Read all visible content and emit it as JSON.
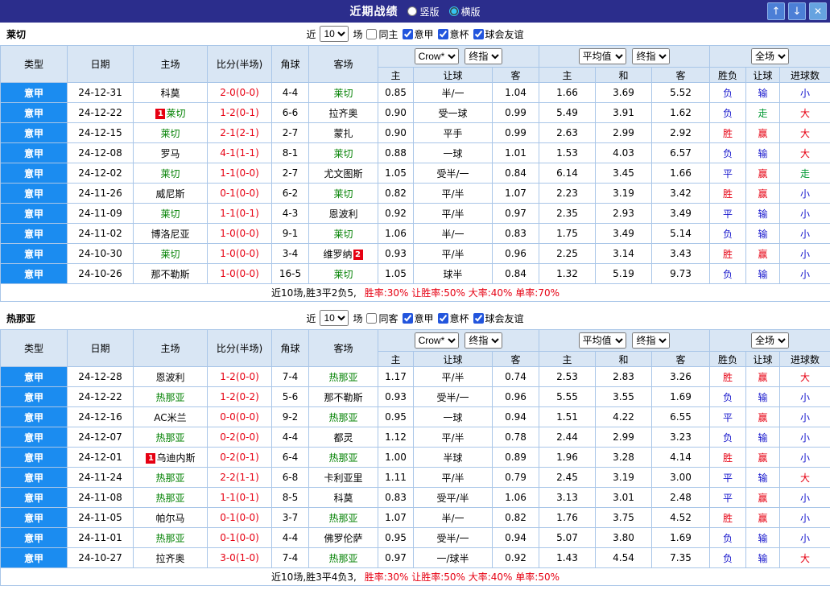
{
  "palette": {
    "r": "#e60012",
    "b": "#1515cc",
    "g": "#009933",
    "league_bg": "#1b8cf0",
    "focal_team": "#008000",
    "score": "#e60012",
    "titlebar_bg": "#2b2d8c"
  },
  "titlebar": {
    "title": "近期战绩",
    "vertical_label": "竖版",
    "horizontal_label": "横版",
    "vertical_selected": false,
    "horizontal_selected": true,
    "up_icon": "↑",
    "down_icon": "↓",
    "close_icon": "✕"
  },
  "labels": {
    "near": "近",
    "count_value": "10",
    "matches": "场",
    "cols": [
      "类型",
      "日期",
      "主场",
      "比分(半场)",
      "角球",
      "客场"
    ],
    "bookmaker": "Crow*",
    "final": "终指",
    "average": "平均值",
    "fulltime": "全场",
    "odds_sub": [
      "主",
      "让球",
      "客"
    ],
    "avg_sub": [
      "主",
      "和",
      "客"
    ],
    "result_sub": [
      "胜负",
      "让球",
      "进球数"
    ]
  },
  "sections": [
    {
      "team": "莱切",
      "filters": [
        {
          "label": "同主",
          "checked": false
        },
        {
          "label": "意甲",
          "checked": true
        },
        {
          "label": "意杯",
          "checked": true
        },
        {
          "label": "球会友谊",
          "checked": true
        }
      ],
      "rows": [
        {
          "league": "意甲",
          "date": "24-12-31",
          "home": {
            "text": "科莫",
            "focal": false
          },
          "score": "2-0(0-0)",
          "corner": "4-4",
          "away": {
            "text": "莱切",
            "focal": true
          },
          "odds": [
            "0.85",
            "半/一",
            "1.04"
          ],
          "avg": [
            "1.66",
            "3.69",
            "5.52"
          ],
          "res": [
            [
              "负",
              "b"
            ],
            [
              "输",
              "b"
            ],
            [
              "小",
              "b"
            ]
          ]
        },
        {
          "league": "意甲",
          "date": "24-12-22",
          "home": {
            "text": "莱切",
            "focal": true,
            "badge": "1",
            "badge_pos": "before"
          },
          "score": "1-2(0-1)",
          "corner": "6-6",
          "away": {
            "text": "拉齐奥",
            "focal": false
          },
          "odds": [
            "0.90",
            "受一球",
            "0.99"
          ],
          "avg": [
            "5.49",
            "3.91",
            "1.62"
          ],
          "res": [
            [
              "负",
              "b"
            ],
            [
              "走",
              "g"
            ],
            [
              "大",
              "r"
            ]
          ]
        },
        {
          "league": "意甲",
          "date": "24-12-15",
          "home": {
            "text": "莱切",
            "focal": true
          },
          "score": "2-1(2-1)",
          "corner": "2-7",
          "away": {
            "text": "蒙扎",
            "focal": false
          },
          "odds": [
            "0.90",
            "平手",
            "0.99"
          ],
          "avg": [
            "2.63",
            "2.99",
            "2.92"
          ],
          "res": [
            [
              "胜",
              "r"
            ],
            [
              "赢",
              "r"
            ],
            [
              "大",
              "r"
            ]
          ]
        },
        {
          "league": "意甲",
          "date": "24-12-08",
          "home": {
            "text": "罗马",
            "focal": false
          },
          "score": "4-1(1-1)",
          "corner": "8-1",
          "away": {
            "text": "莱切",
            "focal": true
          },
          "odds": [
            "0.88",
            "一球",
            "1.01"
          ],
          "avg": [
            "1.53",
            "4.03",
            "6.57"
          ],
          "res": [
            [
              "负",
              "b"
            ],
            [
              "输",
              "b"
            ],
            [
              "大",
              "r"
            ]
          ]
        },
        {
          "league": "意甲",
          "date": "24-12-02",
          "home": {
            "text": "莱切",
            "focal": true
          },
          "score": "1-1(0-0)",
          "corner": "2-7",
          "away": {
            "text": "尤文图斯",
            "focal": false
          },
          "odds": [
            "1.05",
            "受半/一",
            "0.84"
          ],
          "avg": [
            "6.14",
            "3.45",
            "1.66"
          ],
          "res": [
            [
              "平",
              "b"
            ],
            [
              "赢",
              "r"
            ],
            [
              "走",
              "g"
            ]
          ]
        },
        {
          "league": "意甲",
          "date": "24-11-26",
          "home": {
            "text": "威尼斯",
            "focal": false
          },
          "score": "0-1(0-0)",
          "corner": "6-2",
          "away": {
            "text": "莱切",
            "focal": true
          },
          "odds": [
            "0.82",
            "平/半",
            "1.07"
          ],
          "avg": [
            "2.23",
            "3.19",
            "3.42"
          ],
          "res": [
            [
              "胜",
              "r"
            ],
            [
              "赢",
              "r"
            ],
            [
              "小",
              "b"
            ]
          ]
        },
        {
          "league": "意甲",
          "date": "24-11-09",
          "home": {
            "text": "莱切",
            "focal": true
          },
          "score": "1-1(0-1)",
          "corner": "4-3",
          "away": {
            "text": "恩波利",
            "focal": false
          },
          "odds": [
            "0.92",
            "平/半",
            "0.97"
          ],
          "avg": [
            "2.35",
            "2.93",
            "3.49"
          ],
          "res": [
            [
              "平",
              "b"
            ],
            [
              "输",
              "b"
            ],
            [
              "小",
              "b"
            ]
          ]
        },
        {
          "league": "意甲",
          "date": "24-11-02",
          "home": {
            "text": "博洛尼亚",
            "focal": false
          },
          "score": "1-0(0-0)",
          "corner": "9-1",
          "away": {
            "text": "莱切",
            "focal": true
          },
          "odds": [
            "1.06",
            "半/一",
            "0.83"
          ],
          "avg": [
            "1.75",
            "3.49",
            "5.14"
          ],
          "res": [
            [
              "负",
              "b"
            ],
            [
              "输",
              "b"
            ],
            [
              "小",
              "b"
            ]
          ]
        },
        {
          "league": "意甲",
          "date": "24-10-30",
          "home": {
            "text": "莱切",
            "focal": true
          },
          "score": "1-0(0-0)",
          "corner": "3-4",
          "away": {
            "text": "维罗纳",
            "focal": false,
            "badge": "2",
            "badge_pos": "after"
          },
          "odds": [
            "0.93",
            "平/半",
            "0.96"
          ],
          "avg": [
            "2.25",
            "3.14",
            "3.43"
          ],
          "res": [
            [
              "胜",
              "r"
            ],
            [
              "赢",
              "r"
            ],
            [
              "小",
              "b"
            ]
          ]
        },
        {
          "league": "意甲",
          "date": "24-10-26",
          "home": {
            "text": "那不勒斯",
            "focal": false
          },
          "score": "1-0(0-0)",
          "corner": "16-5",
          "away": {
            "text": "莱切",
            "focal": true
          },
          "odds": [
            "1.05",
            "球半",
            "0.84"
          ],
          "avg": [
            "1.32",
            "5.19",
            "9.73"
          ],
          "res": [
            [
              "负",
              "b"
            ],
            [
              "输",
              "b"
            ],
            [
              "小",
              "b"
            ]
          ]
        }
      ],
      "summary_main": "近10场,胜3平2负5,",
      "summary_rates": "胜率:30% 让胜率:50% 大率:40% 单率:70%"
    },
    {
      "team": "热那亚",
      "filters": [
        {
          "label": "同客",
          "checked": false
        },
        {
          "label": "意甲",
          "checked": true
        },
        {
          "label": "意杯",
          "checked": true
        },
        {
          "label": "球会友谊",
          "checked": true
        }
      ],
      "rows": [
        {
          "league": "意甲",
          "date": "24-12-28",
          "home": {
            "text": "恩波利",
            "focal": false
          },
          "score": "1-2(0-0)",
          "corner": "7-4",
          "away": {
            "text": "热那亚",
            "focal": true
          },
          "odds": [
            "1.17",
            "平/半",
            "0.74"
          ],
          "avg": [
            "2.53",
            "2.83",
            "3.26"
          ],
          "res": [
            [
              "胜",
              "r"
            ],
            [
              "赢",
              "r"
            ],
            [
              "大",
              "r"
            ]
          ]
        },
        {
          "league": "意甲",
          "date": "24-12-22",
          "home": {
            "text": "热那亚",
            "focal": true
          },
          "score": "1-2(0-2)",
          "corner": "5-6",
          "away": {
            "text": "那不勒斯",
            "focal": false
          },
          "odds": [
            "0.93",
            "受半/一",
            "0.96"
          ],
          "avg": [
            "5.55",
            "3.55",
            "1.69"
          ],
          "res": [
            [
              "负",
              "b"
            ],
            [
              "输",
              "b"
            ],
            [
              "小",
              "b"
            ]
          ]
        },
        {
          "league": "意甲",
          "date": "24-12-16",
          "home": {
            "text": "AC米兰",
            "focal": false
          },
          "score": "0-0(0-0)",
          "corner": "9-2",
          "away": {
            "text": "热那亚",
            "focal": true
          },
          "odds": [
            "0.95",
            "一球",
            "0.94"
          ],
          "avg": [
            "1.51",
            "4.22",
            "6.55"
          ],
          "res": [
            [
              "平",
              "b"
            ],
            [
              "赢",
              "r"
            ],
            [
              "小",
              "b"
            ]
          ]
        },
        {
          "league": "意甲",
          "date": "24-12-07",
          "home": {
            "text": "热那亚",
            "focal": true
          },
          "score": "0-2(0-0)",
          "corner": "4-4",
          "away": {
            "text": "都灵",
            "focal": false
          },
          "odds": [
            "1.12",
            "平/半",
            "0.78"
          ],
          "avg": [
            "2.44",
            "2.99",
            "3.23"
          ],
          "res": [
            [
              "负",
              "b"
            ],
            [
              "输",
              "b"
            ],
            [
              "小",
              "b"
            ]
          ]
        },
        {
          "league": "意甲",
          "date": "24-12-01",
          "home": {
            "text": "乌迪内斯",
            "focal": false,
            "badge": "1",
            "badge_pos": "before"
          },
          "score": "0-2(0-1)",
          "corner": "6-4",
          "away": {
            "text": "热那亚",
            "focal": true
          },
          "odds": [
            "1.00",
            "半球",
            "0.89"
          ],
          "avg": [
            "1.96",
            "3.28",
            "4.14"
          ],
          "res": [
            [
              "胜",
              "r"
            ],
            [
              "赢",
              "r"
            ],
            [
              "小",
              "b"
            ]
          ]
        },
        {
          "league": "意甲",
          "date": "24-11-24",
          "home": {
            "text": "热那亚",
            "focal": true
          },
          "score": "2-2(1-1)",
          "corner": "6-8",
          "away": {
            "text": "卡利亚里",
            "focal": false
          },
          "odds": [
            "1.11",
            "平/半",
            "0.79"
          ],
          "avg": [
            "2.45",
            "3.19",
            "3.00"
          ],
          "res": [
            [
              "平",
              "b"
            ],
            [
              "输",
              "b"
            ],
            [
              "大",
              "r"
            ]
          ]
        },
        {
          "league": "意甲",
          "date": "24-11-08",
          "home": {
            "text": "热那亚",
            "focal": true
          },
          "score": "1-1(0-1)",
          "corner": "8-5",
          "away": {
            "text": "科莫",
            "focal": false
          },
          "odds": [
            "0.83",
            "受平/半",
            "1.06"
          ],
          "avg": [
            "3.13",
            "3.01",
            "2.48"
          ],
          "res": [
            [
              "平",
              "b"
            ],
            [
              "赢",
              "r"
            ],
            [
              "小",
              "b"
            ]
          ]
        },
        {
          "league": "意甲",
          "date": "24-11-05",
          "home": {
            "text": "帕尔马",
            "focal": false
          },
          "score": "0-1(0-0)",
          "corner": "3-7",
          "away": {
            "text": "热那亚",
            "focal": true
          },
          "odds": [
            "1.07",
            "半/一",
            "0.82"
          ],
          "avg": [
            "1.76",
            "3.75",
            "4.52"
          ],
          "res": [
            [
              "胜",
              "r"
            ],
            [
              "赢",
              "r"
            ],
            [
              "小",
              "b"
            ]
          ]
        },
        {
          "league": "意甲",
          "date": "24-11-01",
          "home": {
            "text": "热那亚",
            "focal": true
          },
          "score": "0-1(0-0)",
          "corner": "4-4",
          "away": {
            "text": "佛罗伦萨",
            "focal": false
          },
          "odds": [
            "0.95",
            "受半/一",
            "0.94"
          ],
          "avg": [
            "5.07",
            "3.80",
            "1.69"
          ],
          "res": [
            [
              "负",
              "b"
            ],
            [
              "输",
              "b"
            ],
            [
              "小",
              "b"
            ]
          ]
        },
        {
          "league": "意甲",
          "date": "24-10-27",
          "home": {
            "text": "拉齐奥",
            "focal": false
          },
          "score": "3-0(1-0)",
          "corner": "7-4",
          "away": {
            "text": "热那亚",
            "focal": true
          },
          "odds": [
            "0.97",
            "一/球半",
            "0.92"
          ],
          "avg": [
            "1.43",
            "4.54",
            "7.35"
          ],
          "res": [
            [
              "负",
              "b"
            ],
            [
              "输",
              "b"
            ],
            [
              "大",
              "r"
            ]
          ]
        }
      ],
      "summary_main": "近10场,胜3平4负3,",
      "summary_rates": "胜率:30% 让胜率:50% 大率:40% 单率:50%"
    }
  ]
}
